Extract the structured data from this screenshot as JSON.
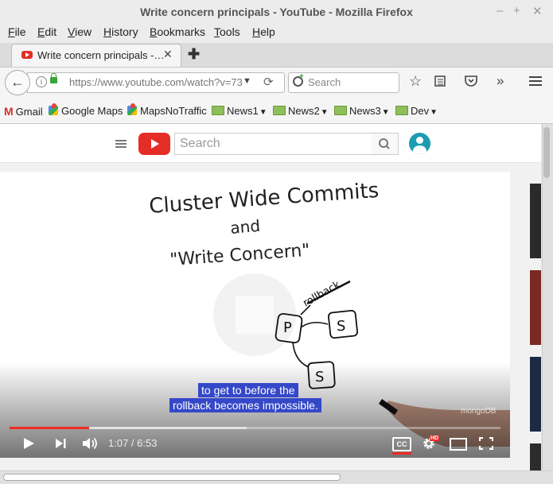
{
  "window": {
    "title": "Write concern principals - YouTube - Mozilla Firefox"
  },
  "menubar": {
    "items": [
      {
        "label": "File",
        "u": "F",
        "rest": "ile"
      },
      {
        "label": "Edit",
        "u": "E",
        "rest": "dit"
      },
      {
        "label": "View",
        "u": "V",
        "rest": "iew"
      },
      {
        "label": "History",
        "u": "H",
        "rest": "istory"
      },
      {
        "label": "Bookmarks",
        "u": "B",
        "rest": "ookmarks"
      },
      {
        "label": "Tools",
        "u": "T",
        "rest": "ools"
      },
      {
        "label": "Help",
        "u": "H",
        "rest": "elp"
      }
    ]
  },
  "tab": {
    "title": "Write concern principals -…",
    "close": "✕"
  },
  "navbar": {
    "url": "https://www.youtube.com/watch?v=73",
    "search_placeholder": "Search"
  },
  "bookmarks": [
    {
      "label": "Gmail",
      "icon": "gmail-icon"
    },
    {
      "label": "Google Maps",
      "icon": "maps-icon"
    },
    {
      "label": "MapsNoTraffic",
      "icon": "maps-icon"
    },
    {
      "label": "News1",
      "icon": "folder-icon"
    },
    {
      "label": "News2",
      "icon": "folder-icon"
    },
    {
      "label": "News3",
      "icon": "folder-icon"
    },
    {
      "label": "Dev",
      "icon": "folder-icon"
    }
  ],
  "youtube": {
    "search_placeholder": "Search",
    "brand_color": "#e52d27"
  },
  "video": {
    "whiteboard": {
      "line1": "Cluster Wide Commits",
      "line2": "and",
      "line3": "\"Write Concern\"",
      "node_p": "P",
      "node_s1": "S",
      "node_s2": "S",
      "rollback": "rollback"
    },
    "captions": [
      "to get to before the",
      "rollback becomes impossible."
    ],
    "watermark": "mongoDB",
    "time": "1:07 / 6:53",
    "progress": 0.162,
    "cc_label": "CC",
    "hd_label": "HD"
  }
}
